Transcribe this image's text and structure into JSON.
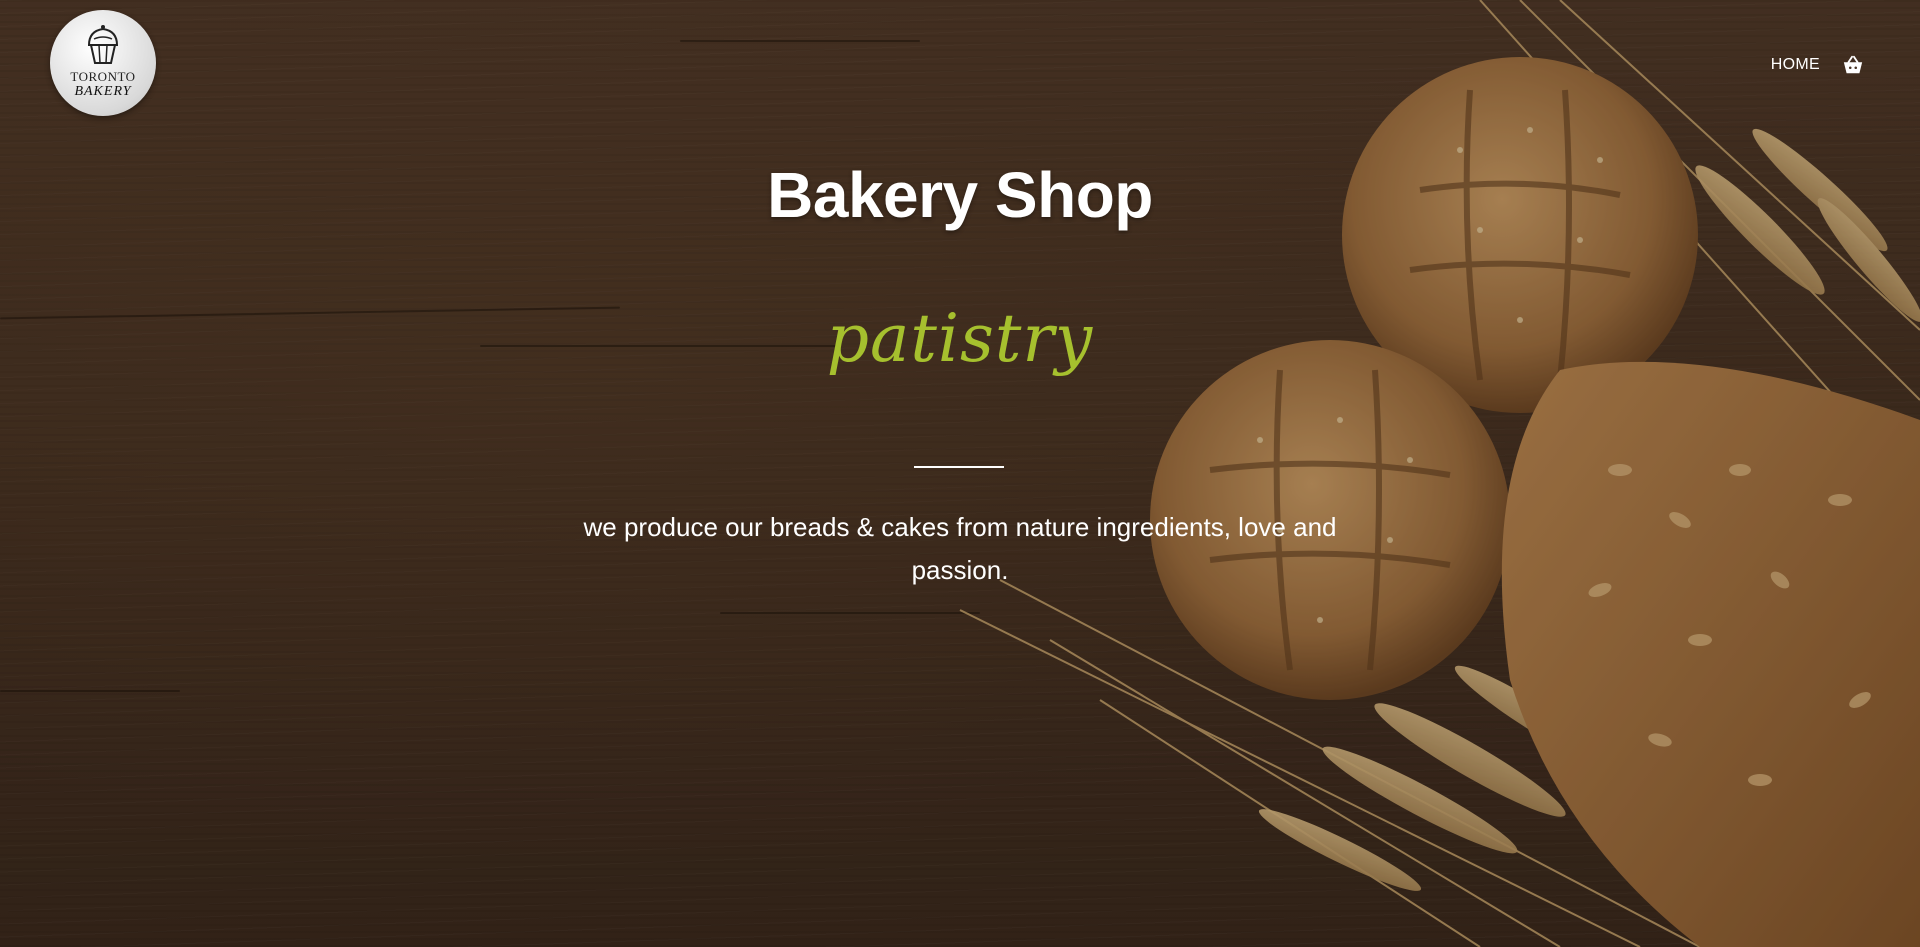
{
  "logo": {
    "line1": "TORONTO",
    "line2": "BAKERY",
    "icon": "cupcake-icon"
  },
  "nav": {
    "home_label": "HOME",
    "cart_icon": "basket-icon"
  },
  "hero": {
    "title": "Bakery Shop",
    "tagline": "patistry",
    "description": "we produce our breads & cakes from nature ingredients, love and passion."
  },
  "colors": {
    "accent": "#a6c02e",
    "text": "#ffffff",
    "wood_dark": "#3f2d21",
    "wood_mid": "#5a4130"
  }
}
